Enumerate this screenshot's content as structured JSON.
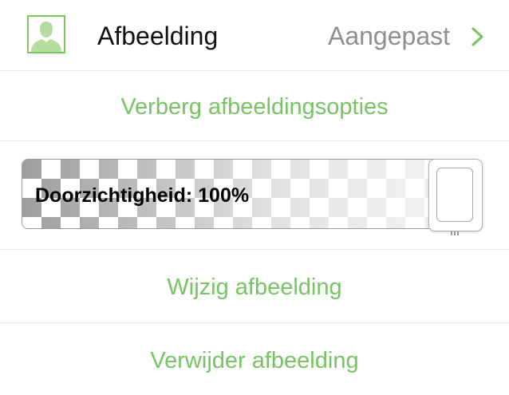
{
  "header": {
    "title": "Afbeelding",
    "value": "Aangepast",
    "avatar_icon": "person-silhouette-icon",
    "chevron_icon": "chevron-right-icon"
  },
  "actions": {
    "hide_options": "Verberg afbeeldingsopties",
    "change_image": "Wijzig afbeelding",
    "remove_image": "Verwijder afbeelding"
  },
  "opacity_slider": {
    "label": "Doorzichtigheid: 100%",
    "value_percent": 100
  },
  "colors": {
    "accent": "#76c463",
    "avatar_fill": "#b5dd9f",
    "secondary_text": "#8e8e93",
    "divider": "#e5e5ea"
  }
}
